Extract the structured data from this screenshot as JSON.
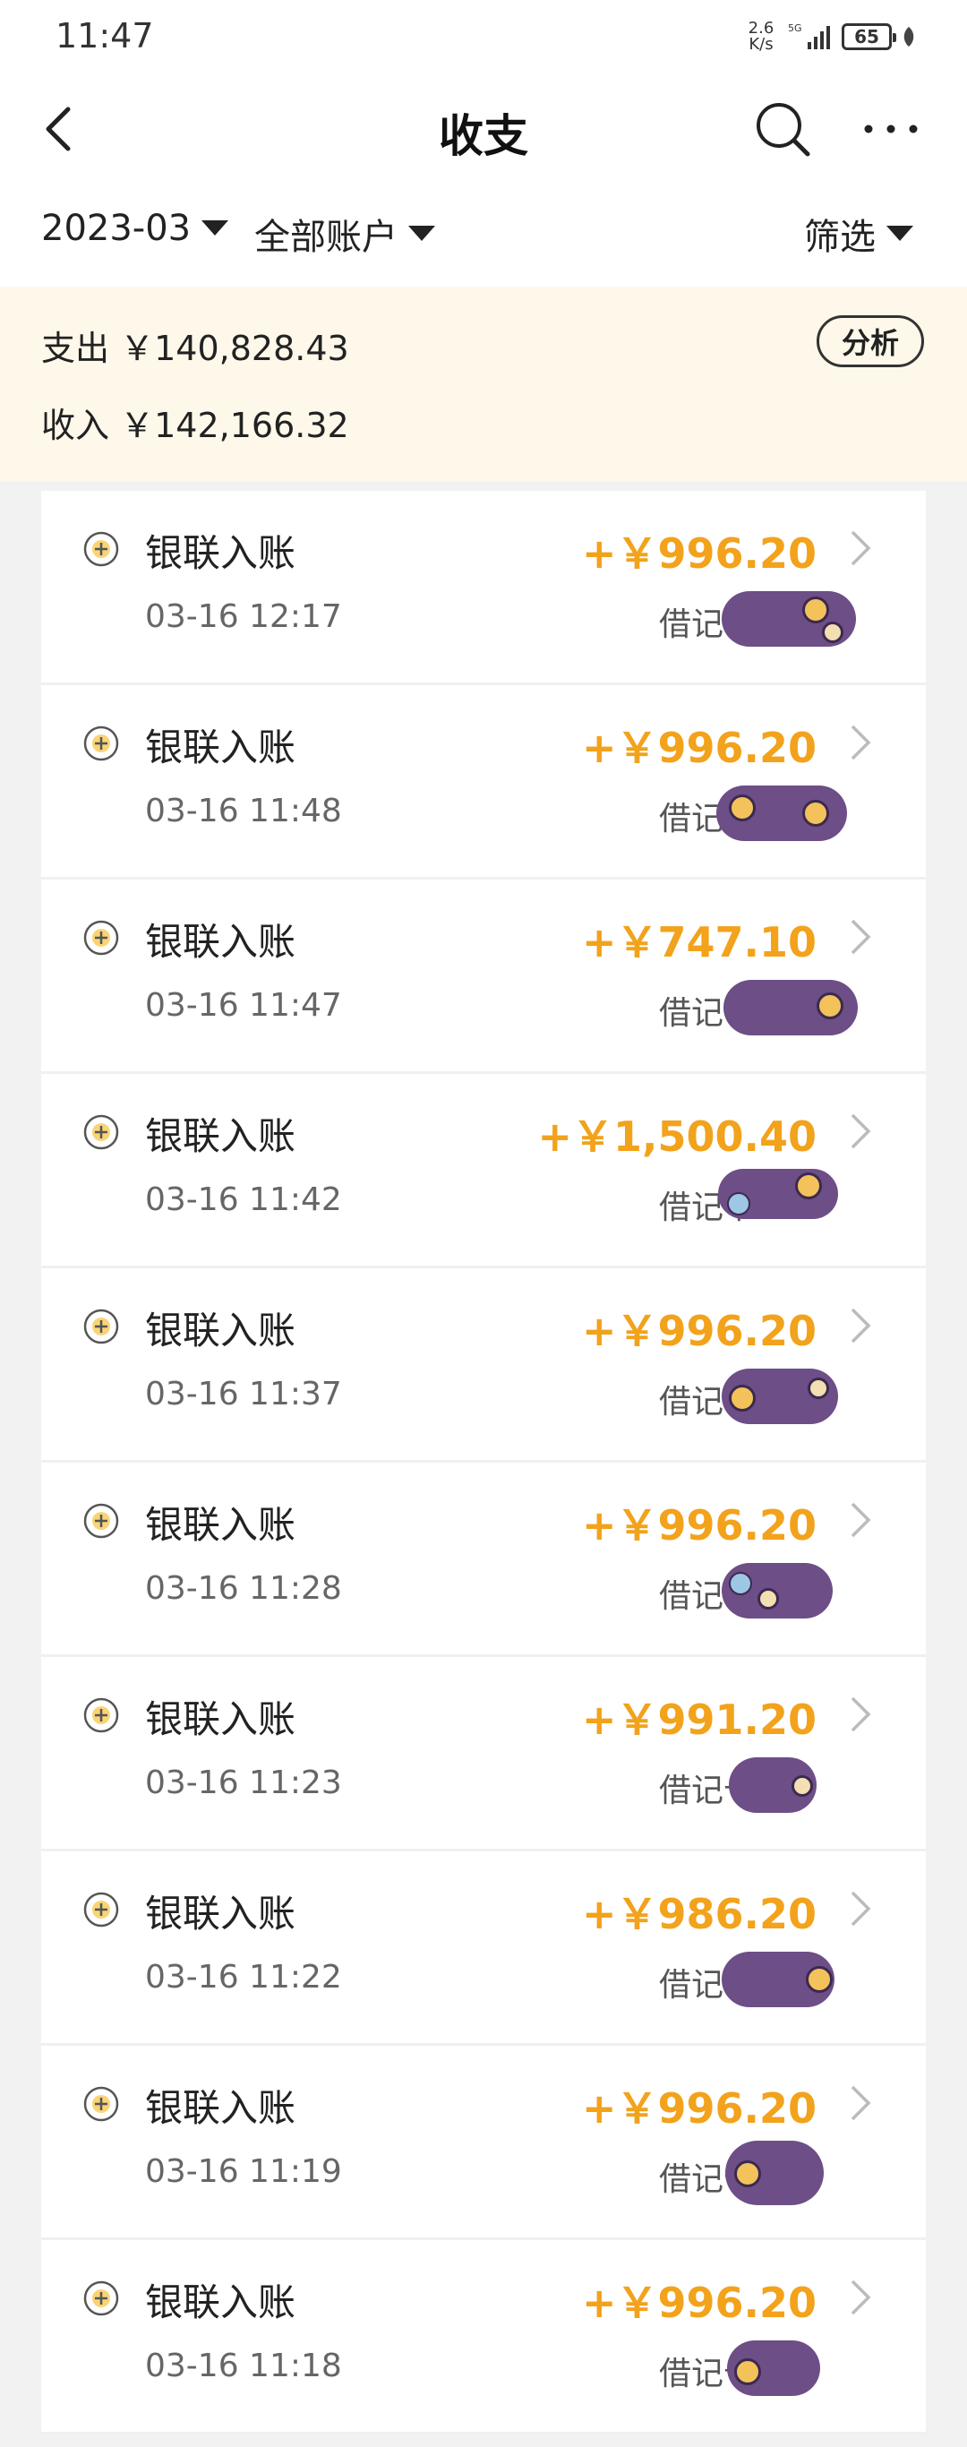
{
  "status_bar": {
    "time": "11:47",
    "net_speed_value": "2.6",
    "net_speed_unit": "K/s",
    "signal_label": "5G",
    "battery": "65"
  },
  "nav": {
    "title": "收支"
  },
  "filters": {
    "month": "2023-03",
    "account": "全部账户",
    "filter_label": "筛选"
  },
  "summary": {
    "expense_label": "支出",
    "expense_value": "￥140,828.43",
    "income_label": "收入",
    "income_value": "￥142,166.32",
    "analyze_label": "分析"
  },
  "transactions": [
    {
      "title": "银联入账",
      "amount": "+￥996.20",
      "time": "03-16 12:17",
      "account": "借记卡"
    },
    {
      "title": "银联入账",
      "amount": "+￥996.20",
      "time": "03-16 11:48",
      "account": "借记卡"
    },
    {
      "title": "银联入账",
      "amount": "+￥747.10",
      "time": "03-16 11:47",
      "account": "借记卡"
    },
    {
      "title": "银联入账",
      "amount": "+￥1,500.40",
      "time": "03-16 11:42",
      "account": "借记卡"
    },
    {
      "title": "银联入账",
      "amount": "+￥996.20",
      "time": "03-16 11:37",
      "account": "借记卡"
    },
    {
      "title": "银联入账",
      "amount": "+￥996.20",
      "time": "03-16 11:28",
      "account": "借记卡"
    },
    {
      "title": "银联入账",
      "amount": "+￥991.20",
      "time": "03-16 11:23",
      "account": "借记卡"
    },
    {
      "title": "银联入账",
      "amount": "+￥986.20",
      "time": "03-16 11:22",
      "account": "借记卡"
    },
    {
      "title": "银联入账",
      "amount": "+￥996.20",
      "time": "03-16 11:19",
      "account": "借记卡"
    },
    {
      "title": "银联入账",
      "amount": "+￥996.20",
      "time": "03-16 11:18",
      "account": "借记卡"
    }
  ],
  "colors": {
    "amount": "#f2a21b",
    "summary_bg": "#fdf8ea",
    "redaction": "#6d4e86"
  },
  "icons": {
    "back": "back-arrow-icon",
    "search": "search-icon",
    "more": "more-icon",
    "income_row": "plus-circle-icon",
    "row_chevron": "chevron-right-icon"
  }
}
